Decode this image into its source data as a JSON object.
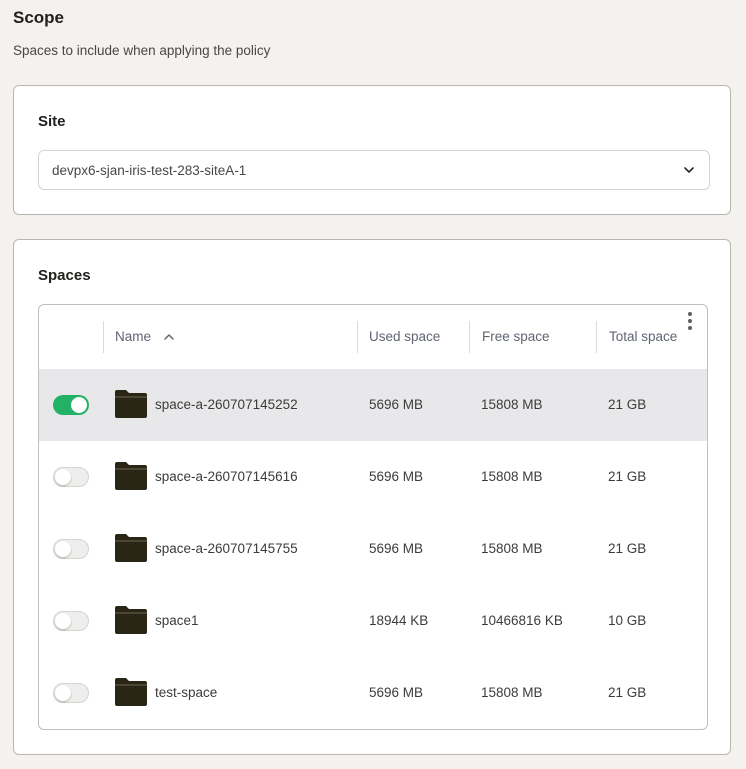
{
  "scope": {
    "title": "Scope",
    "subtitle": "Spaces to include when applying the policy"
  },
  "site": {
    "title": "Site",
    "selected": "devpx6-sjan-iris-test-283-siteA-1"
  },
  "spaces": {
    "title": "Spaces",
    "columns": {
      "name": "Name",
      "used": "Used space",
      "free": "Free space",
      "total": "Total space"
    },
    "sort": "ascending",
    "rows": [
      {
        "enabled": true,
        "name": "space-a-260707145252",
        "used": "5696 MB",
        "free": "15808 MB",
        "total": "21 GB"
      },
      {
        "enabled": false,
        "name": "space-a-260707145616",
        "used": "5696 MB",
        "free": "15808 MB",
        "total": "21 GB"
      },
      {
        "enabled": false,
        "name": "space-a-260707145755",
        "used": "5696 MB",
        "free": "15808 MB",
        "total": "21 GB"
      },
      {
        "enabled": false,
        "name": "space1",
        "used": "18944 KB",
        "free": "10466816 KB",
        "total": "10 GB"
      },
      {
        "enabled": false,
        "name": "test-space",
        "used": "5696 MB",
        "free": "15808 MB",
        "total": "21 GB"
      }
    ]
  },
  "icons": {
    "chevron": "chevron-down-icon",
    "sort": "sort-ascending-icon",
    "menu": "more-vertical-icon",
    "folder": "folder-icon"
  },
  "colors": {
    "toggle_on": "#23b265",
    "selected_row": "#e8e7e9",
    "folder": "#2a2615"
  }
}
